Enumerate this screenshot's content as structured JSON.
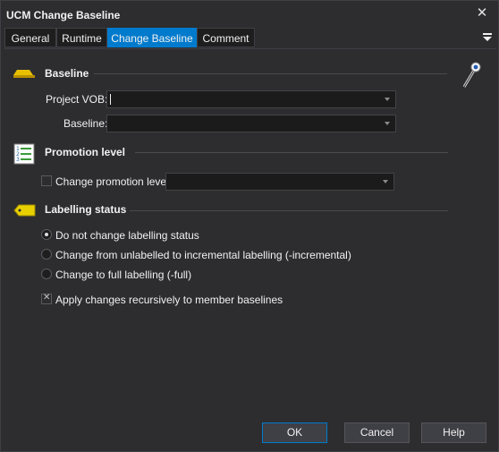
{
  "window": {
    "title": "UCM Change Baseline"
  },
  "tabs": [
    {
      "label": "General"
    },
    {
      "label": "Runtime"
    },
    {
      "label": "Change Baseline"
    },
    {
      "label": "Comment"
    }
  ],
  "active_tab": "Change Baseline",
  "sections": {
    "baseline": {
      "title": "Baseline",
      "project_vob_label": "Project VOB:",
      "project_vob_value": "",
      "baseline_label": "Baseline:",
      "baseline_value": ""
    },
    "promotion": {
      "title": "Promotion level",
      "change_label": "Change promotion level:",
      "checked": false,
      "value": ""
    },
    "labelling": {
      "title": "Labelling status",
      "options": [
        {
          "label": "Do not change labelling status",
          "selected": true
        },
        {
          "label": "Change from unlabelled to incremental labelling (-incremental)",
          "selected": false
        },
        {
          "label": "Change to full labelling (-full)",
          "selected": false
        }
      ],
      "recursive_label": "Apply changes recursively to member baselines",
      "recursive_checked": true
    }
  },
  "buttons": {
    "ok": "OK",
    "cancel": "Cancel",
    "help": "Help"
  },
  "colors": {
    "accent": "#007acc",
    "background": "#2d2d30",
    "field": "#1b1b1c"
  }
}
